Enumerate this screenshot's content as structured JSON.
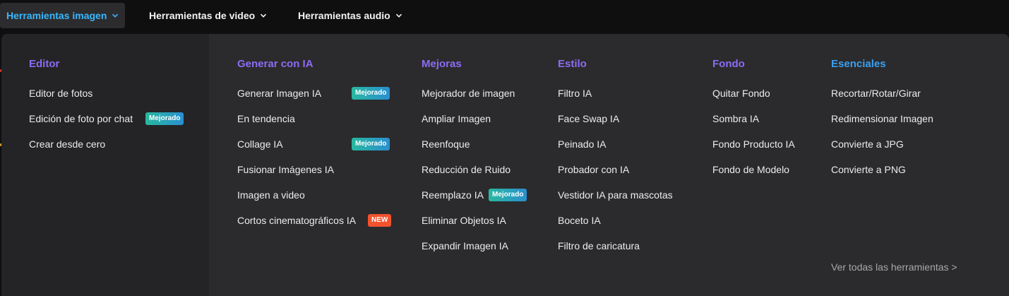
{
  "topnav": {
    "items": [
      {
        "label": "Herramientas imagen",
        "active": true
      },
      {
        "label": "Herramientas de video",
        "active": false
      },
      {
        "label": "Herramientas audio",
        "active": false
      }
    ]
  },
  "colors": {
    "accent_blue": "#39b7ff",
    "title_purple": "#8a6df0",
    "panel_bg": "#2b2b2d",
    "badge_new": "#f2522e"
  },
  "columns": {
    "editor": {
      "title": "Editor",
      "items": [
        "Editor de fotos",
        "Edición de foto por chat",
        "Crear desde cero"
      ],
      "badges": {
        "1": "Mejorado"
      }
    },
    "generate": {
      "title": "Generar con IA",
      "items": [
        "Generar Imagen IA",
        "En tendencia",
        "Collage IA",
        "Fusionar Imágenes IA",
        "Imagen a video",
        "Cortos cinematográficos IA"
      ],
      "badges": {
        "0": "Mejorado",
        "2": "Mejorado",
        "5": "NEW"
      }
    },
    "improve": {
      "title": "Mejoras",
      "items": [
        "Mejorador de imagen",
        "Ampliar Imagen",
        "Reenfoque",
        "Reducción de Ruido",
        "Reemplazo IA",
        "Eliminar Objetos IA",
        "Expandir Imagen IA"
      ],
      "badges": {
        "4": "Mejorado"
      }
    },
    "style": {
      "title": "Estilo",
      "items": [
        "Filtro IA",
        "Face Swap IA",
        "Peinado IA",
        "Probador con IA",
        "Vestidor IA para mascotas",
        "Boceto IA",
        "Filtro de caricatura"
      ]
    },
    "background": {
      "title": "Fondo",
      "items": [
        "Quitar Fondo",
        "Sombra IA",
        "Fondo Producto IA",
        "Fondo de Modelo"
      ]
    },
    "essentials": {
      "title": "Esenciales",
      "items": [
        "Recortar/Rotar/Girar",
        "Redimensionar Imagen",
        "Convierte a JPG",
        "Convierte a PNG"
      ]
    }
  },
  "see_all": "Ver todas las herramientas >"
}
